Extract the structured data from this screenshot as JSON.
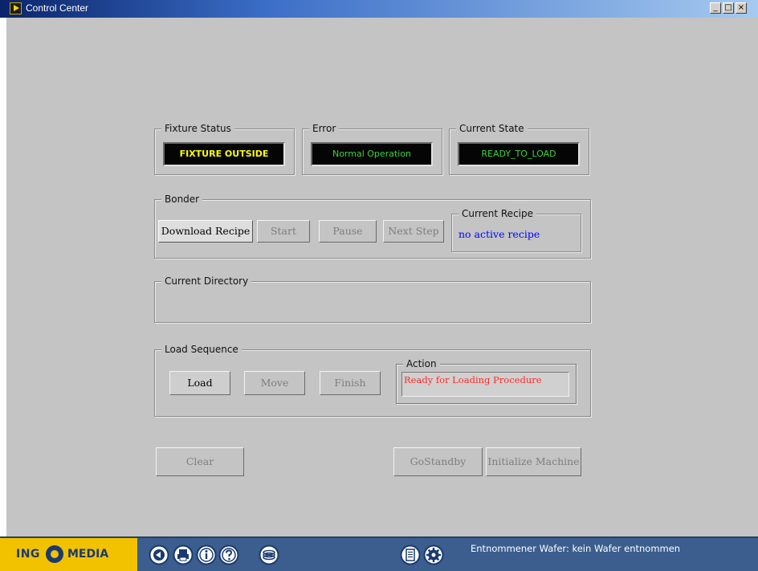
{
  "window": {
    "title": "Control Center",
    "minimize": "_",
    "maximize": "□",
    "close": "×"
  },
  "fixture_status": {
    "label": "Fixture Status",
    "value": "FIXTURE OUTSIDE",
    "color": "#ffff00"
  },
  "error": {
    "label": "Error",
    "value": "Normal Operation",
    "color": "#37d737"
  },
  "current_state": {
    "label": "Current State",
    "value": "READY_TO_LOAD",
    "color": "#37d737"
  },
  "bonder": {
    "label": "Bonder",
    "download_recipe": "Download Recipe",
    "start": "Start",
    "pause": "Pause",
    "next_step": "Next Step",
    "current_recipe_label": "Current Recipe",
    "current_recipe_value": "no active recipe",
    "recipe_color": "#0000ff"
  },
  "current_directory": {
    "label": "Current Directory",
    "value": ""
  },
  "load_sequence": {
    "label": "Load Sequence",
    "load": "Load",
    "move": "Move",
    "finish": "Finish",
    "action_label": "Action",
    "action_value": "Ready for Loading Procedure",
    "action_color": "#ff2a2a"
  },
  "bottom_buttons": {
    "clear": "Clear",
    "go_standby": "GoStandby",
    "initialize_machine": "Initialize Machine"
  },
  "footer": {
    "logo_left": "ING",
    "logo_right": "MEDIA",
    "icons": [
      "back-icon",
      "print-icon",
      "info-icon",
      "help-icon",
      "stack-icon",
      "document-icon",
      "settings-gear-icon"
    ],
    "status_text": "Entnommener Wafer:  kein Wafer entnommen"
  }
}
